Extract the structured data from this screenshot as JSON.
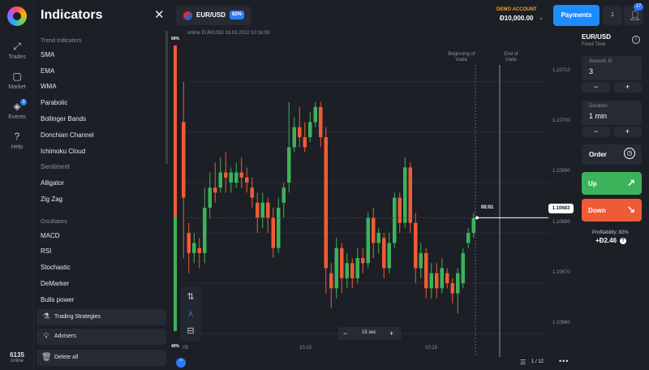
{
  "rail": {
    "items": [
      {
        "label": "Trades",
        "icon": "trades-icon"
      },
      {
        "label": "Market",
        "icon": "market-icon"
      },
      {
        "label": "Events",
        "icon": "events-icon",
        "badge": "3"
      },
      {
        "label": "Help",
        "icon": "help-icon"
      }
    ],
    "online_count": "6135",
    "online_label": "online"
  },
  "panel": {
    "title": "Indicators",
    "sections": [
      {
        "header": "Trend Indicators",
        "items": [
          "SMA",
          "EMA",
          "WMA",
          "Parabolic",
          "Bollinger Bands",
          "Donchian Channel",
          "Ichimoku Cloud"
        ]
      },
      {
        "header": "Sentiment",
        "items": [
          "Alligator",
          "Zig Zag"
        ]
      },
      {
        "header": "Oscillators",
        "items": [
          "MACD",
          "RSI",
          "Stochastic",
          "DeMarker",
          "Bulls power"
        ]
      }
    ],
    "buttons": [
      "Trading Strategies",
      "Advisers",
      "Delete all"
    ]
  },
  "header": {
    "asset": "EUR/USD",
    "asset_pct": "82%",
    "account_label": "DEMO ACCOUNT",
    "account_balance": "Đ10,000.00",
    "payments_label": "Payments",
    "small_btn_label": "1",
    "profile_badge": "17"
  },
  "chart": {
    "info": "online EUR/USD  18.03.2022 10:16:59",
    "pct_top": "60%",
    "pct_bottom": "40%",
    "beginning_label": "Beginning of trade",
    "end_label": "End of trade",
    "timer": "00:01",
    "current_price": "1.10683",
    "zoom_value": "15 sec",
    "pager": "1 / 12",
    "colors": {
      "up": "#3cb35a",
      "down": "#ef5b35",
      "grid": "#2a2e37"
    }
  },
  "chart_data": {
    "type": "candlestick",
    "y_ticks": [
      "1.10710",
      "1.10700",
      "1.10690",
      "1.10680",
      "1.10670",
      "1.10660"
    ],
    "x_ticks": [
      ":05",
      "10:10",
      "10:15"
    ],
    "ylim": [
      1.10656,
      1.10719
    ],
    "sentiment_bar": {
      "up_pct": 60,
      "down_pct": 40
    },
    "candles": [
      {
        "o": 1.10702,
        "c": 1.10687,
        "h": 1.1071,
        "l": 1.10675
      },
      {
        "o": 1.1068,
        "c": 1.10676,
        "h": 1.10682,
        "l": 1.10672
      },
      {
        "o": 1.10676,
        "c": 1.10678,
        "h": 1.1068,
        "l": 1.10674
      },
      {
        "o": 1.10677,
        "c": 1.10676,
        "h": 1.10679,
        "l": 1.10673
      },
      {
        "o": 1.10676,
        "c": 1.10685,
        "h": 1.10689,
        "l": 1.10674
      },
      {
        "o": 1.10685,
        "c": 1.10689,
        "h": 1.10692,
        "l": 1.10683
      },
      {
        "o": 1.10689,
        "c": 1.10688,
        "h": 1.10694,
        "l": 1.10686
      },
      {
        "o": 1.10689,
        "c": 1.10692,
        "h": 1.10695,
        "l": 1.10688
      },
      {
        "o": 1.10692,
        "c": 1.10691,
        "h": 1.10696,
        "l": 1.10688
      },
      {
        "o": 1.1069,
        "c": 1.10692,
        "h": 1.10693,
        "l": 1.10688
      },
      {
        "o": 1.1069,
        "c": 1.10692,
        "h": 1.10694,
        "l": 1.10689
      },
      {
        "o": 1.10692,
        "c": 1.10691,
        "h": 1.10695,
        "l": 1.10689
      },
      {
        "o": 1.10691,
        "c": 1.1069,
        "h": 1.10693,
        "l": 1.10688
      },
      {
        "o": 1.10689,
        "c": 1.10687,
        "h": 1.10691,
        "l": 1.10685
      },
      {
        "o": 1.10686,
        "c": 1.10683,
        "h": 1.10688,
        "l": 1.1068
      },
      {
        "o": 1.10683,
        "c": 1.10686,
        "h": 1.10688,
        "l": 1.10681
      },
      {
        "o": 1.10686,
        "c": 1.10683,
        "h": 1.10687,
        "l": 1.1068
      },
      {
        "o": 1.10683,
        "c": 1.10677,
        "h": 1.10685,
        "l": 1.10675
      },
      {
        "o": 1.10677,
        "c": 1.10685,
        "h": 1.10687,
        "l": 1.10676
      },
      {
        "o": 1.10686,
        "c": 1.10689,
        "h": 1.1069,
        "l": 1.10683
      },
      {
        "o": 1.1069,
        "c": 1.10697,
        "h": 1.10706,
        "l": 1.10688
      },
      {
        "o": 1.10697,
        "c": 1.10701,
        "h": 1.10703,
        "l": 1.10696
      },
      {
        "o": 1.10701,
        "c": 1.10699,
        "h": 1.10705,
        "l": 1.10697
      },
      {
        "o": 1.10699,
        "c": 1.10697,
        "h": 1.10702,
        "l": 1.10696
      },
      {
        "o": 1.10699,
        "c": 1.10702,
        "h": 1.10704,
        "l": 1.10698
      },
      {
        "o": 1.10702,
        "c": 1.10705,
        "h": 1.10706,
        "l": 1.10701
      },
      {
        "o": 1.10705,
        "c": 1.10699,
        "h": 1.10706,
        "l": 1.10697
      },
      {
        "o": 1.10699,
        "c": 1.10673,
        "h": 1.10701,
        "l": 1.10668
      },
      {
        "o": 1.10672,
        "c": 1.10669,
        "h": 1.10674,
        "l": 1.10665
      },
      {
        "o": 1.10669,
        "c": 1.10677,
        "h": 1.10679,
        "l": 1.10667
      },
      {
        "o": 1.10677,
        "c": 1.10671,
        "h": 1.10678,
        "l": 1.10668
      },
      {
        "o": 1.10671,
        "c": 1.10674,
        "h": 1.10676,
        "l": 1.10669
      },
      {
        "o": 1.10674,
        "c": 1.10671,
        "h": 1.10675,
        "l": 1.10669
      },
      {
        "o": 1.10671,
        "c": 1.10675,
        "h": 1.10677,
        "l": 1.1067
      },
      {
        "o": 1.10675,
        "c": 1.10674,
        "h": 1.10677,
        "l": 1.10672
      },
      {
        "o": 1.10674,
        "c": 1.10683,
        "h": 1.10684,
        "l": 1.10673
      },
      {
        "o": 1.10683,
        "c": 1.10678,
        "h": 1.10685,
        "l": 1.10675
      },
      {
        "o": 1.10678,
        "c": 1.1068,
        "h": 1.10681,
        "l": 1.10676
      },
      {
        "o": 1.10679,
        "c": 1.10673,
        "h": 1.1068,
        "l": 1.10671
      },
      {
        "o": 1.10673,
        "c": 1.10678,
        "h": 1.1068,
        "l": 1.10672
      },
      {
        "o": 1.10678,
        "c": 1.10687,
        "h": 1.10688,
        "l": 1.10677
      },
      {
        "o": 1.10687,
        "c": 1.10682,
        "h": 1.10688,
        "l": 1.1068
      },
      {
        "o": 1.10682,
        "c": 1.10693,
        "h": 1.10695,
        "l": 1.10681
      },
      {
        "o": 1.10693,
        "c": 1.10682,
        "h": 1.10694,
        "l": 1.1068
      },
      {
        "o": 1.10682,
        "c": 1.10673,
        "h": 1.10684,
        "l": 1.1067
      },
      {
        "o": 1.10673,
        "c": 1.10676,
        "h": 1.10678,
        "l": 1.10671
      },
      {
        "o": 1.10676,
        "c": 1.10669,
        "h": 1.10677,
        "l": 1.10667
      },
      {
        "o": 1.10669,
        "c": 1.10672,
        "h": 1.10674,
        "l": 1.10667
      },
      {
        "o": 1.10672,
        "c": 1.10669,
        "h": 1.10674,
        "l": 1.10667
      },
      {
        "o": 1.10669,
        "c": 1.10673,
        "h": 1.10675,
        "l": 1.10668
      },
      {
        "o": 1.10672,
        "c": 1.1067,
        "h": 1.10673,
        "l": 1.10669
      },
      {
        "o": 1.1067,
        "c": 1.10668,
        "h": 1.10671,
        "l": 1.10666
      },
      {
        "o": 1.10668,
        "c": 1.10672,
        "h": 1.10673,
        "l": 1.10664
      },
      {
        "o": 1.1067,
        "c": 1.10676,
        "h": 1.10677,
        "l": 1.10669
      },
      {
        "o": 1.10678,
        "c": 1.1068,
        "h": 1.10681,
        "l": 1.10677
      },
      {
        "o": 1.1068,
        "c": 1.10683,
        "h": 1.10684,
        "l": 1.10679
      }
    ]
  },
  "trade": {
    "asset": "EUR/USD",
    "type": "Fixed Time",
    "amount_label": "Amount, Đ",
    "amount_value": "3",
    "duration_label": "Duration",
    "duration_value": "1 min",
    "minus": "−",
    "plus": "+",
    "order_label": "Order",
    "up_label": "Up",
    "down_label": "Down",
    "profitability_label": "Profitability: 82%",
    "profitability_value": "+Đ2.46"
  }
}
